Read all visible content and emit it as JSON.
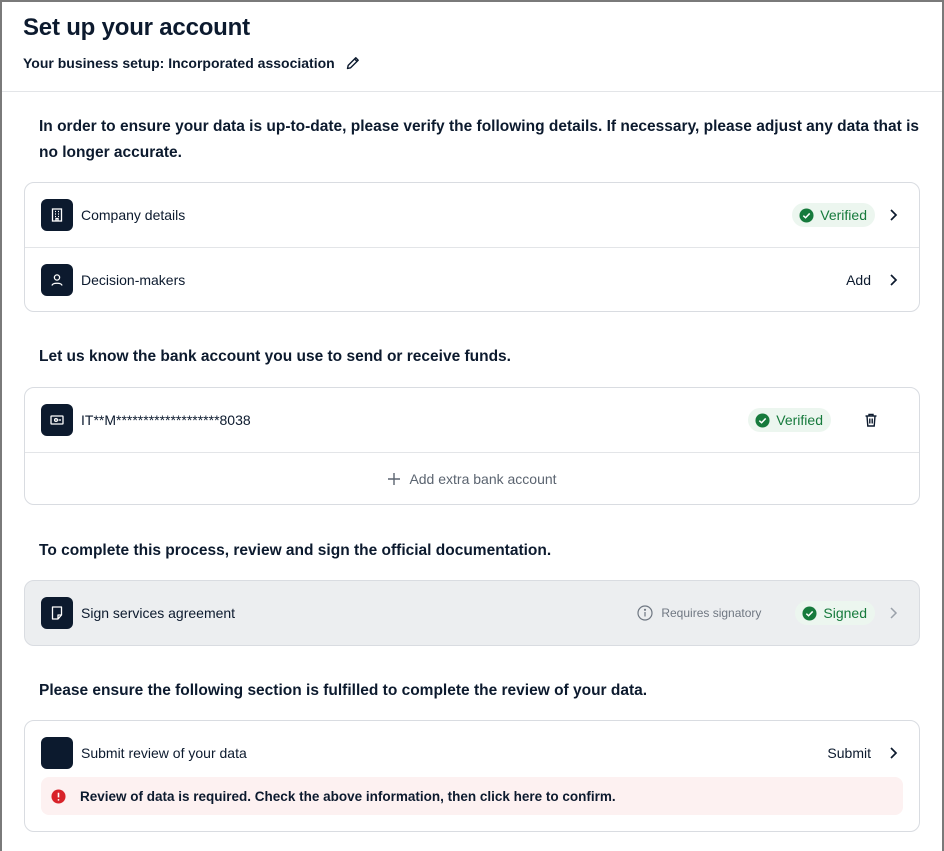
{
  "header": {
    "title": "Set up your account",
    "business_setup": "Your business setup: Incorporated association"
  },
  "sections": {
    "verify_intro": "In order to ensure your data is up-to-date, please verify the following details. If necessary, please adjust any data that is no longer accurate.",
    "bank_intro": "Let us know the bank account you use to send or receive funds.",
    "docs_intro": "To complete this process, review and sign the official documentation.",
    "review_intro": "Please ensure the following section is fulfilled to complete the review of your data."
  },
  "details": {
    "company": {
      "label": "Company details",
      "status": "Verified",
      "icon": "building-icon"
    },
    "decision_makers": {
      "label": "Decision-makers",
      "action": "Add",
      "icon": "person-icon"
    }
  },
  "bank": {
    "account": "IT**M*******************8038",
    "status": "Verified",
    "add_label": "Add extra bank account",
    "icon": "bank-card-icon"
  },
  "agreement": {
    "label": "Sign services agreement",
    "note": "Requires signatory",
    "status": "Signed",
    "icon": "document-icon"
  },
  "review": {
    "label": "Submit review of your data",
    "action": "Submit",
    "error": "Review of data is required. Check the above information, then click here to confirm."
  },
  "colors": {
    "navy": "#0c1a2e",
    "verified_green": "#167a3c",
    "badge_bg": "#ecf6ef",
    "error_red": "#d8232a",
    "error_bg": "#fdf1f1",
    "disabled_bg": "#eceef0"
  }
}
